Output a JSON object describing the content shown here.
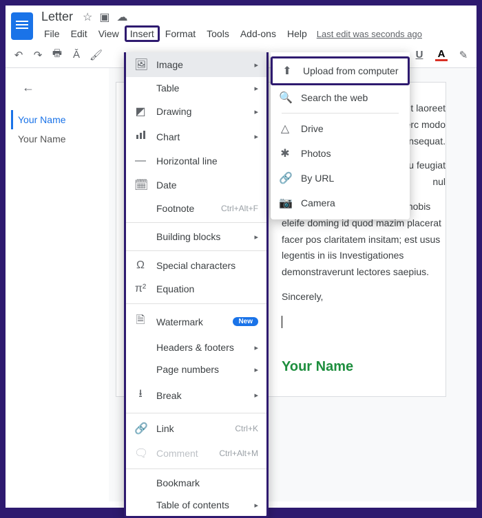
{
  "title": "Letter",
  "menubar": [
    "File",
    "Edit",
    "View",
    "Insert",
    "Format",
    "Tools",
    "Add-ons",
    "Help"
  ],
  "last_edit": "Last edit was seconds ago",
  "toolbar_right": {
    "underline": "U",
    "text_color": "A"
  },
  "outline": {
    "items": [
      {
        "label": "Your Name",
        "active": true
      },
      {
        "label": "Your Name",
        "active": false
      }
    ]
  },
  "insert_menu": {
    "image": "Image",
    "table": "Table",
    "drawing": "Drawing",
    "chart": "Chart",
    "hline": "Horizontal line",
    "date": "Date",
    "footnote": "Footnote",
    "footnote_shortcut": "Ctrl+Alt+F",
    "building_blocks": "Building blocks",
    "special_chars": "Special characters",
    "equation": "Equation",
    "watermark": "Watermark",
    "watermark_badge": "New",
    "headers_footers": "Headers & footers",
    "page_numbers": "Page numbers",
    "break": "Break",
    "link": "Link",
    "link_shortcut": "Ctrl+K",
    "comment": "Comment",
    "comment_shortcut": "Ctrl+Alt+M",
    "bookmark": "Bookmark",
    "toc": "Table of contents"
  },
  "image_submenu": {
    "upload": "Upload from computer",
    "search": "Search the web",
    "drive": "Drive",
    "photos": "Photos",
    "by_url": "By URL",
    "camera": "Camera"
  },
  "document": {
    "p1": "net, consectetuer t laoreet dolore quis nostrud exerc modo consequat.",
    "p2": "e dolor in hendre re eu feugiat nul",
    "p3": "Nam liber tempor cum soluta nobis eleife doming id quod mazim placerat facer pos claritatem insitam; est usus legentis in iis Investigationes demonstraverunt lectores saepius.",
    "sincerely": "Sincerely,",
    "signature": "Your Name"
  }
}
